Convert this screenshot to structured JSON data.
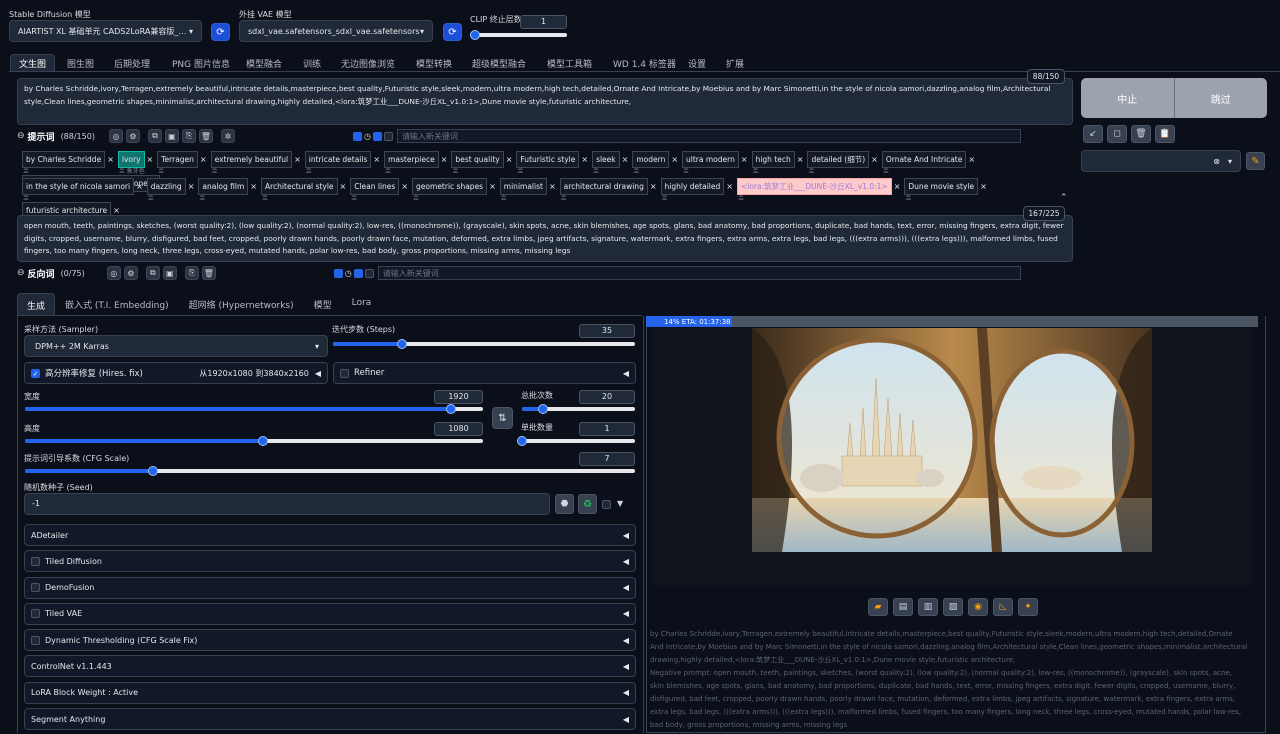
{
  "header": {
    "model_label": "Stable Diffusion 模型",
    "model_value": "AIARTIST XL 基础单元 CADS2LoRA兼容版_UNIT",
    "vae_label": "外挂 VAE 模型",
    "vae_value": "sdxl_vae.safetensors_sdxl_vae.safetensors",
    "clip_label": "CLIP 终止层数",
    "clip_value": "1",
    "clip_fraction": 0.02
  },
  "tabs": [
    "文生图",
    "图生图",
    "后期处理",
    "PNG 图片信息",
    "模型融合",
    "训练",
    "无边图像浏览",
    "模型转换",
    "超级模型融合",
    "模型工具箱",
    "WD 1.4 标签器",
    "设置",
    "扩展"
  ],
  "prompt": {
    "text": "by Charles Schridde,ivory,Terragen,extremely beautiful,intricate details,masterpiece,best quality,Futuristic style,sleek,modern,ultra modern,high tech,detailed,Ornate And Intricate,by Moebius and by Marc Simonetti,in the style of nicola samori,dazzling,analog film,Architectural style,Clean lines,geometric shapes,minimalist,architectural drawing,highly detailed,<lora:筑梦工业___DUNE-沙丘XL_v1.0:1>,Dune movie style,futuristic architecture,",
    "counter": "88/150",
    "label": "提示词",
    "count": "(88/150)",
    "input_placeholder": "请输入新关键词",
    "tags_row1": [
      {
        "t": "by Charles Schridde"
      },
      {
        "t": "ivory",
        "sub": "象牙色",
        "hl": "teal"
      },
      {
        "t": "Terragen"
      },
      {
        "t": "extremely beautiful"
      },
      {
        "t": "intricate details"
      },
      {
        "t": "masterpiece"
      },
      {
        "t": "best quality"
      },
      {
        "t": "Futuristic style"
      },
      {
        "t": "sleek"
      },
      {
        "t": "modern"
      },
      {
        "t": "ultra modern"
      },
      {
        "t": "high tech"
      },
      {
        "t": "detailed (细节)"
      },
      {
        "t": "Ornate And Intricate"
      },
      {
        "t": "by Moebius and by Marc Simonetti"
      }
    ],
    "tags_row2": [
      {
        "t": "in the style of nicola samori"
      },
      {
        "t": "dazzling"
      },
      {
        "t": "analog film"
      },
      {
        "t": "Architectural style"
      },
      {
        "t": "Clean lines"
      },
      {
        "t": "geometric shapes"
      },
      {
        "t": "minimalist"
      },
      {
        "t": "architectural drawing"
      },
      {
        "t": "highly detailed"
      },
      {
        "t": "<lora:筑梦工业___DUNE-沙丘XL_v1.0:1>",
        "hl": "lora"
      },
      {
        "t": "Dune movie style"
      },
      {
        "t": "futuristic architecture"
      }
    ]
  },
  "negative": {
    "text": "open mouth, teeth, paintings, sketches, (worst quality:2), (low quality:2), (normal quality:2), low-res, ((monochrome)), (grayscale), skin spots, acne, skin blemishes, age spots, glans, bad anatomy, bad proportions, duplicate, bad hands, text, error, missing fingers, extra digit, fewer digits, cropped, username, blurry, disfigured, bad feet, cropped, poorly drawn hands, poorly drawn face, mutation, deformed, extra limbs, jpeg artifacts, signature, watermark, extra fingers, extra arms, extra legs, bad legs, (((extra arms))), (((extra legs))), malformed limbs, fused fingers, too many fingers, long neck, three legs, cross-eyed, mutated hands, polar low-res, bad body, gross proportions, missing arms, missing legs",
    "counter": "167/225",
    "label": "反向词",
    "count": "(0/75)",
    "input_placeholder": "请输入新关键词"
  },
  "actions": {
    "interrupt": "中止",
    "skip": "跳过"
  },
  "subtabs": [
    "生成",
    "嵌入式 (T.I. Embedding)",
    "超网络 (Hypernetworks)",
    "模型",
    "Lora"
  ],
  "params": {
    "sampler_label": "采样方法 (Sampler)",
    "sampler_value": "DPM++ 2M Karras",
    "steps_label": "迭代步数 (Steps)",
    "steps_value": "35",
    "steps_fraction": 0.23,
    "hires_label": "高分辨率修复 (Hires. fix)",
    "hires_info": "从1920x1080 到3840x2160",
    "refiner_label": "Refiner",
    "width_label": "宽度",
    "width_value": "1920",
    "width_fraction": 0.93,
    "height_label": "高度",
    "height_value": "1080",
    "height_fraction": 0.52,
    "batch_count_label": "总批次数",
    "batch_count_value": "20",
    "batch_count_fraction": 0.19,
    "batch_size_label": "单批数量",
    "batch_size_value": "1",
    "batch_size_fraction": 0.0,
    "cfg_label": "提示词引导系数 (CFG Scale)",
    "cfg_value": "7",
    "cfg_fraction": 0.21,
    "seed_label": "随机数种子 (Seed)",
    "seed_value": "-1"
  },
  "accordions": [
    {
      "label": "ADetailer",
      "cb": false
    },
    {
      "label": "Tiled Diffusion",
      "cb": true
    },
    {
      "label": "DemoFusion",
      "cb": true
    },
    {
      "label": "Tiled VAE",
      "cb": true
    },
    {
      "label": "Dynamic Thresholding (CFG Scale Fix)",
      "cb": true
    },
    {
      "label": "ControlNet v1.1.443",
      "cb": false
    },
    {
      "label": "LoRA Block Weight : Active",
      "cb": false
    },
    {
      "label": "Segment Anything",
      "cb": false
    }
  ],
  "output": {
    "progress_text": "14% ETA: 01:37:38",
    "progress_fraction": 0.14,
    "caption_prompt": "by Charles Schridde,ivory,Terragen,extremely beautiful,intricate details,masterpiece,best quality,Futuristic style,sleek,modern,ultra modern,high tech,detailed,Ornate And Intricate,by Moebius and by Marc Simonetti,in the style of nicola samori,dazzling,analog film,Architectural style,Clean lines,geometric shapes,minimalist,architectural drawing,highly detailed,<lora:筑梦工业___DUNE-沙丘XL_v1.0:1>,Dune movie style,futuristic architecture,",
    "caption_negative": "Negative prompt: open mouth, teeth, paintings, sketches, (worst quality:2), (low quality:2), (normal quality:2), low-res, ((monochrome)), (grayscale), skin spots, acne, skin blemishes, age spots, glans, bad anatomy, bad proportions, duplicate, bad hands, text, error, missing fingers, extra digit, fewer digits, cropped, username, blurry, disfigured, bad feet, cropped, poorly drawn hands, poorly drawn face, mutation, deformed, extra limbs, jpeg artifacts, signature, watermark, extra fingers, extra arms, extra legs, bad legs, (((extra arms))), (((extra legs))), malformed limbs, fused fingers, too many fingers, long neck, three legs, cross-eyed, mutated hands, polar low-res, bad body, gross proportions, missing arms, missing legs"
  },
  "colors": {
    "accent": "#2563eb",
    "bg": "#0b0f19",
    "panel": "#111827",
    "field": "#1f2937",
    "tag_teal": "#0f766e",
    "lora_tag": "#fca5a5"
  }
}
